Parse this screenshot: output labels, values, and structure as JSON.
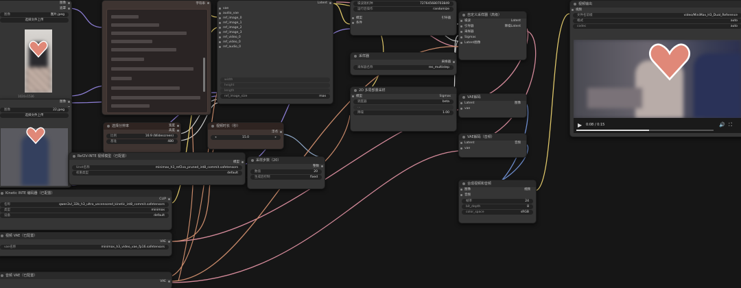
{
  "nodes": {
    "load_image_1": {
      "upload_label": "选择文件上传",
      "filename": "图片.jpeg",
      "out_image": "图像",
      "out_mask": "遮罩",
      "size_caption": "1024×1536"
    },
    "load_image_2": {
      "upload_label": "选择文件上传",
      "filename": "22.jpeg",
      "out_image": "图像",
      "out_mask": "遮罩"
    },
    "text_node": {
      "corner_label": "字符串"
    },
    "big_node": {
      "inputs": [
        "vae",
        "audio_vae",
        "ref_image_0",
        "ref_image_1",
        "ref_image_2",
        "ref_image_3",
        "ref_video_0",
        "ref_video_0",
        "ref_audio_0"
      ],
      "out": "Latent",
      "ref_image_size_label": "ref_image_size",
      "ref_image_size_value": "max",
      "grey_slots": [
        "width",
        "height",
        "length"
      ]
    },
    "resolution": {
      "title": "选择分辨率",
      "out_width": "宽度",
      "out_height": "高度",
      "ratio_label": "比例",
      "ratio_value": "16:9 (Widescreen)",
      "base_label": "基准",
      "base_value": "480"
    },
    "video_length": {
      "title": "视频时长（秒）",
      "out": "浮点",
      "value": "15.0"
    },
    "model_loader": {
      "title": "Ref2V-INTE 视频模型（已配置）",
      "unet_label": "Unet名称",
      "unet_value": "minimax_h3_ref2va_pruned_int8_commit.safetensors",
      "dtype_label": "权重类型",
      "dtype_value": "default",
      "out": "模型"
    },
    "text_encoder": {
      "title": "Kinetic INTE 编码器（已配置）",
      "out": "CLIP",
      "name_label": "名称",
      "name_value": "qwen3vl_32b_h3_ultra_uncensored_kinetic_int8_commit.safetensors",
      "type_label": "类型",
      "type_value": "minimax",
      "device_label": "设备",
      "device_value": "default"
    },
    "vae_loader": {
      "title": "视频 VAE（已配置）",
      "out": "VAE",
      "name_label": "vae名称",
      "name_value": "minimax_h3_video_vae_fp16.safetensors"
    },
    "vae_loader_2": {
      "title": "音频 VAE（已配置）",
      "out": "VAE"
    },
    "noise": {
      "seed_label": "噪波随机种",
      "seed_value": "727645680703849",
      "control_label": "运行后操作",
      "control_value": "randomize",
      "in_model": "模型",
      "in_cond": "条件",
      "out": "引导器"
    },
    "sampler_select": {
      "title": "采样器",
      "out": "采样器",
      "name_label": "采样器名称",
      "name_value": "res_multistep"
    },
    "scheduler": {
      "title": "2D 多局部量采样",
      "in_model": "模型",
      "out": "Sigmas",
      "sched_label": "调度器",
      "sched_value": "beta",
      "denoise_label": "降噪",
      "denoise_value": "1.00"
    },
    "steps": {
      "title": "采样步数（20）",
      "out": "整数",
      "value_label": "数值",
      "value": "20",
      "control_label": "生成后控制",
      "control_value": "fixed"
    },
    "custom_sampler": {
      "title": "自定义采样器（高级）",
      "in": [
        "噪波",
        "引导器",
        "采样器",
        "Sigmas",
        "Latent图像"
      ],
      "out_a": "Latent",
      "out_b": "降噪Latent"
    },
    "vae_decode": {
      "title": "VAE解码",
      "in_latent": "Latent",
      "in_vae": "vae",
      "out": "图像"
    },
    "vae_decode_audio": {
      "title": "VAE解码（音频）",
      "in_latent": "Latent",
      "in_vae": "vae",
      "out": "音频"
    },
    "create_video": {
      "title": "合成视频和音频",
      "in_image": "图像",
      "in_audio": "音频",
      "out": "视频",
      "fps_label": "帧率",
      "fps_value": "24",
      "bit_depth_label": "bit_depth",
      "bit_depth_value": "8",
      "color_label": "color_space",
      "color_value": "sRGB"
    },
    "video_preview": {
      "title": "视频输出",
      "in": "视频",
      "prefix_label": "文件名前缀",
      "prefix_value": "video/MiniMax_H3_Dual_Reference",
      "format_label": "格式",
      "format_value": "auto",
      "codec_label": "codec",
      "codec_value": "auto",
      "time": "0:08 / 0:15"
    }
  },
  "colors": {
    "wire_purple": "#8d7fd6",
    "wire_yellow": "#e0c86a",
    "wire_orange": "#c98a6a",
    "wire_pink": "#d48a9a",
    "wire_white": "#cfcfcf",
    "wire_blue": "#6f8fd0",
    "heart": "#e08878"
  }
}
